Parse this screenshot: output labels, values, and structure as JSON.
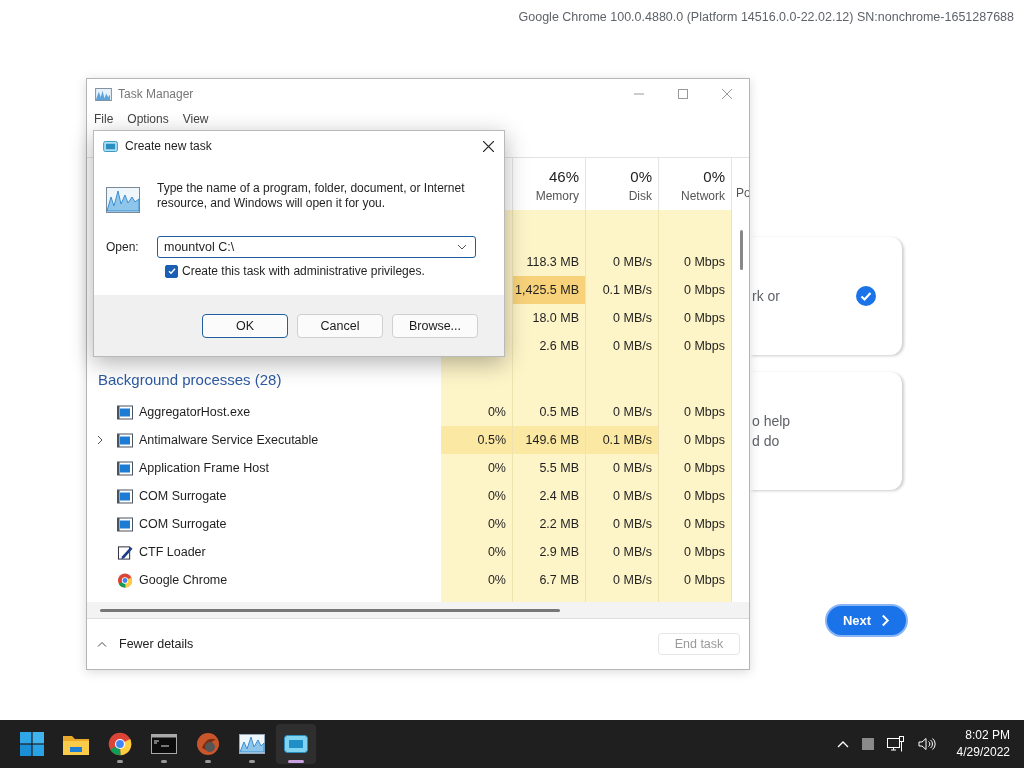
{
  "build_info": "Google Chrome 100.0.4880.0 (Platform 14516.0.0-22.02.12) SN:nonchrome-1651287688",
  "setup_cards": [
    {
      "lines": [
        "rk or"
      ],
      "selected": true
    },
    {
      "lines": [
        "o help",
        "d do"
      ],
      "selected": false
    }
  ],
  "next_button": "Next",
  "task_manager": {
    "title": "Task Manager",
    "active": false,
    "menu": [
      "File",
      "Options",
      "View"
    ],
    "columns": [
      {
        "total": "46%",
        "label": "Memory"
      },
      {
        "total": "0%",
        "label": "Disk"
      },
      {
        "total": "0%",
        "label": "Network"
      },
      {
        "label": "Po"
      }
    ],
    "groups": [
      {
        "rows": [
          {
            "cells": [
              {
                "text": "118.3 MB",
                "color": "#fdf4c8"
              },
              {
                "text": "0 MB/s",
                "color": "#fdf4c8"
              },
              {
                "text": "0 Mbps",
                "color": "#fdf4c8"
              }
            ]
          },
          {
            "cells": [
              {
                "text": "1,425.5 MB",
                "color": "#f8d27a"
              },
              {
                "text": "0.1 MB/s",
                "color": "#fdf4c8"
              },
              {
                "text": "0 Mbps",
                "color": "#fdf4c8"
              }
            ]
          },
          {
            "cells": [
              {
                "text": "18.0 MB",
                "color": "#fdf4c8"
              },
              {
                "text": "0 MB/s",
                "color": "#fdf4c8"
              },
              {
                "text": "0 Mbps",
                "color": "#fdf4c8"
              }
            ]
          },
          {
            "cells": [
              {
                "text": "2.6 MB",
                "color": "#fdf4c8"
              },
              {
                "text": "0 MB/s",
                "color": "#fdf4c8"
              },
              {
                "text": "0 Mbps",
                "color": "#fdf4c8"
              }
            ]
          }
        ]
      },
      {
        "title": "Background processes (28)",
        "rows": [
          {
            "name": "AggregatorHost.exe",
            "kind": "service",
            "expandable": false,
            "cells": [
              {
                "text": "0%",
                "color": "#fdf4c8"
              },
              {
                "text": "0.5 MB",
                "color": "#fdf4c8"
              },
              {
                "text": "0 MB/s",
                "color": "#fdf4c8"
              },
              {
                "text": "0 Mbps",
                "color": "#fdf4c8"
              }
            ]
          },
          {
            "name": "Antimalware Service Executable",
            "kind": "service",
            "expandable": true,
            "cells": [
              {
                "text": "0.5%",
                "color": "#fbe8a3"
              },
              {
                "text": "149.6 MB",
                "color": "#fbe8a3"
              },
              {
                "text": "0.1 MB/s",
                "color": "#fbe8a3"
              },
              {
                "text": "0 Mbps",
                "color": "#fdf4c8"
              }
            ]
          },
          {
            "name": "Application Frame Host",
            "kind": "service",
            "expandable": false,
            "cells": [
              {
                "text": "0%",
                "color": "#fdf4c8"
              },
              {
                "text": "5.5 MB",
                "color": "#fdf4c8"
              },
              {
                "text": "0 MB/s",
                "color": "#fdf4c8"
              },
              {
                "text": "0 Mbps",
                "color": "#fdf4c8"
              }
            ]
          },
          {
            "name": "COM Surrogate",
            "kind": "service",
            "expandable": false,
            "cells": [
              {
                "text": "0%",
                "color": "#fdf4c8"
              },
              {
                "text": "2.4 MB",
                "color": "#fdf4c8"
              },
              {
                "text": "0 MB/s",
                "color": "#fdf4c8"
              },
              {
                "text": "0 Mbps",
                "color": "#fdf4c8"
              }
            ]
          },
          {
            "name": "COM Surrogate",
            "kind": "service",
            "expandable": false,
            "cells": [
              {
                "text": "0%",
                "color": "#fdf4c8"
              },
              {
                "text": "2.2 MB",
                "color": "#fdf4c8"
              },
              {
                "text": "0 MB/s",
                "color": "#fdf4c8"
              },
              {
                "text": "0 Mbps",
                "color": "#fdf4c8"
              }
            ]
          },
          {
            "name": "CTF Loader",
            "kind": "pen",
            "expandable": false,
            "cells": [
              {
                "text": "0%",
                "color": "#fdf4c8"
              },
              {
                "text": "2.9 MB",
                "color": "#fdf4c8"
              },
              {
                "text": "0 MB/s",
                "color": "#fdf4c8"
              },
              {
                "text": "0 Mbps",
                "color": "#fdf4c8"
              }
            ]
          },
          {
            "name": "Google Chrome",
            "kind": "chrome",
            "expandable": false,
            "cells": [
              {
                "text": "0%",
                "color": "#fdf4c8"
              },
              {
                "text": "6.7 MB",
                "color": "#fdf4c8"
              },
              {
                "text": "0 MB/s",
                "color": "#fdf4c8"
              },
              {
                "text": "0 Mbps",
                "color": "#fdf4c8"
              }
            ]
          }
        ]
      }
    ],
    "fewer_details": "Fewer details",
    "end_task": {
      "label": "End task",
      "disabled": true
    }
  },
  "dialog": {
    "title": "Create new task",
    "message": "Type the name of a program, folder, document, or Internet resource, and Windows will open it for you.",
    "open_label": "Open:",
    "open_value": "mountvol C:\\",
    "admin": {
      "label": "Create this task with administrative privileges.",
      "checked": true
    },
    "buttons": [
      {
        "label": "OK",
        "default": true
      },
      {
        "label": "Cancel",
        "default": false
      },
      {
        "label": "Browse...",
        "default": false
      }
    ]
  },
  "taskbar": {
    "apps": [
      {
        "kind": "start",
        "running": false,
        "active": false
      },
      {
        "kind": "folder",
        "running": false,
        "active": false
      },
      {
        "kind": "chrome",
        "running": true,
        "active": false
      },
      {
        "kind": "terminal",
        "running": true,
        "active": false
      },
      {
        "kind": "bird",
        "running": true,
        "active": false
      },
      {
        "kind": "taskmgr",
        "running": true,
        "active": false
      },
      {
        "kind": "window",
        "running": true,
        "active": true
      }
    ],
    "time": "8:02 PM",
    "date": "4/29/2022"
  }
}
